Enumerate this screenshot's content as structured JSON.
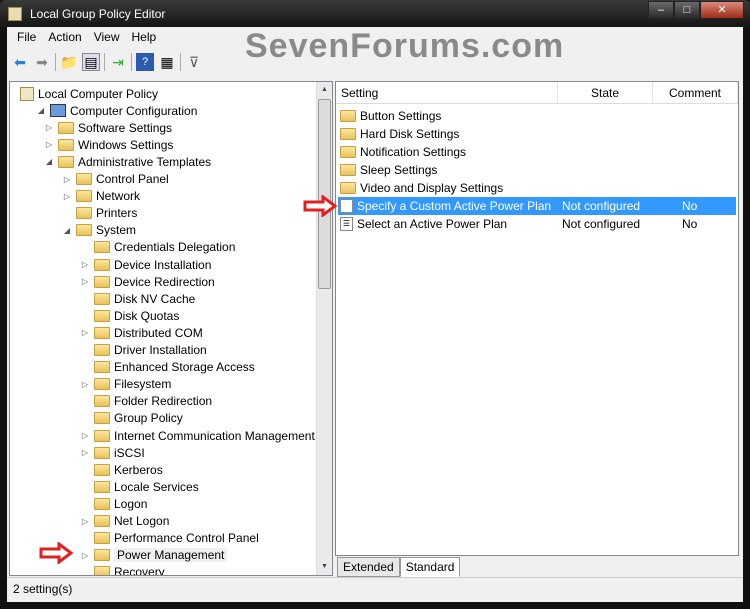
{
  "window": {
    "title": "Local Group Policy Editor",
    "min": "–",
    "max": "□",
    "close": "✕"
  },
  "watermark": "SevenForums.com",
  "menu": [
    "File",
    "Action",
    "View",
    "Help"
  ],
  "tree": [
    {
      "label": "Local Computer Policy",
      "level": 0,
      "arrow": "",
      "icon": "policy"
    },
    {
      "label": "Computer Configuration",
      "level": 1,
      "arrow": "expanded",
      "icon": "computer"
    },
    {
      "label": "Software Settings",
      "level": 2,
      "arrow": "collapsed",
      "icon": "folder"
    },
    {
      "label": "Windows Settings",
      "level": 2,
      "arrow": "collapsed",
      "icon": "folder"
    },
    {
      "label": "Administrative Templates",
      "level": 2,
      "arrow": "expanded",
      "icon": "folder"
    },
    {
      "label": "Control Panel",
      "level": 3,
      "arrow": "collapsed",
      "icon": "folder"
    },
    {
      "label": "Network",
      "level": 3,
      "arrow": "collapsed",
      "icon": "folder"
    },
    {
      "label": "Printers",
      "level": 3,
      "arrow": "",
      "icon": "folder"
    },
    {
      "label": "System",
      "level": 3,
      "arrow": "expanded",
      "icon": "folder"
    },
    {
      "label": "Credentials Delegation",
      "level": 4,
      "arrow": "",
      "icon": "folder"
    },
    {
      "label": "Device Installation",
      "level": 4,
      "arrow": "collapsed",
      "icon": "folder"
    },
    {
      "label": "Device Redirection",
      "level": 4,
      "arrow": "collapsed",
      "icon": "folder"
    },
    {
      "label": "Disk NV Cache",
      "level": 4,
      "arrow": "",
      "icon": "folder"
    },
    {
      "label": "Disk Quotas",
      "level": 4,
      "arrow": "",
      "icon": "folder"
    },
    {
      "label": "Distributed COM",
      "level": 4,
      "arrow": "collapsed",
      "icon": "folder"
    },
    {
      "label": "Driver Installation",
      "level": 4,
      "arrow": "",
      "icon": "folder"
    },
    {
      "label": "Enhanced Storage Access",
      "level": 4,
      "arrow": "",
      "icon": "folder"
    },
    {
      "label": "Filesystem",
      "level": 4,
      "arrow": "collapsed",
      "icon": "folder"
    },
    {
      "label": "Folder Redirection",
      "level": 4,
      "arrow": "",
      "icon": "folder"
    },
    {
      "label": "Group Policy",
      "level": 4,
      "arrow": "",
      "icon": "folder"
    },
    {
      "label": "Internet Communication Management",
      "level": 4,
      "arrow": "collapsed",
      "icon": "folder"
    },
    {
      "label": "iSCSI",
      "level": 4,
      "arrow": "collapsed",
      "icon": "folder"
    },
    {
      "label": "Kerberos",
      "level": 4,
      "arrow": "",
      "icon": "folder"
    },
    {
      "label": "Locale Services",
      "level": 4,
      "arrow": "",
      "icon": "folder"
    },
    {
      "label": "Logon",
      "level": 4,
      "arrow": "",
      "icon": "folder"
    },
    {
      "label": "Net Logon",
      "level": 4,
      "arrow": "collapsed",
      "icon": "folder"
    },
    {
      "label": "Performance Control Panel",
      "level": 4,
      "arrow": "",
      "icon": "folder"
    },
    {
      "label": "Power Management",
      "level": 4,
      "arrow": "collapsed",
      "icon": "folder",
      "selected": true
    },
    {
      "label": "Recovery",
      "level": 4,
      "arrow": "",
      "icon": "folder"
    }
  ],
  "list": {
    "headers": {
      "setting": "Setting",
      "state": "State",
      "comment": "Comment"
    },
    "rows": [
      {
        "setting": "Button Settings",
        "state": "",
        "comment": "",
        "icon": "folder"
      },
      {
        "setting": "Hard Disk Settings",
        "state": "",
        "comment": "",
        "icon": "folder"
      },
      {
        "setting": "Notification Settings",
        "state": "",
        "comment": "",
        "icon": "folder"
      },
      {
        "setting": "Sleep Settings",
        "state": "",
        "comment": "",
        "icon": "folder"
      },
      {
        "setting": "Video and Display Settings",
        "state": "",
        "comment": "",
        "icon": "folder"
      },
      {
        "setting": "Specify a Custom Active Power Plan",
        "state": "Not configured",
        "comment": "No",
        "icon": "setting",
        "selected": true
      },
      {
        "setting": "Select an Active Power Plan",
        "state": "Not configured",
        "comment": "No",
        "icon": "setting"
      }
    ]
  },
  "tabs": [
    "Extended",
    "Standard"
  ],
  "active_tab": "Standard",
  "status": "2 setting(s)",
  "colors": {
    "selection": "#3399ff",
    "annotation_arrow": "#e02020"
  }
}
